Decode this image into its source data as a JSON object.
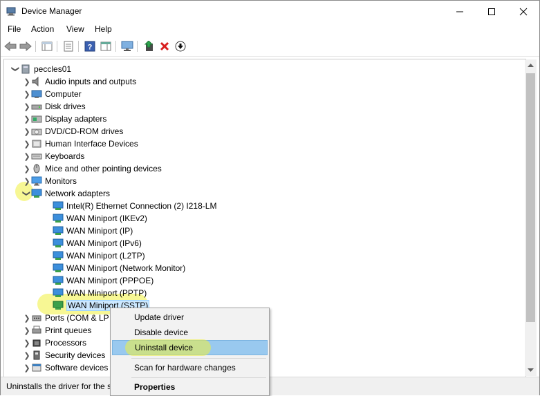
{
  "window": {
    "title": "Device Manager",
    "app_icon": "device-manager-icon"
  },
  "menu": [
    "File",
    "Action",
    "View",
    "Help"
  ],
  "toolbar_icons": [
    "back-arrow-icon",
    "forward-arrow-icon",
    "show-hide-tree-icon",
    "properties-icon",
    "help-icon",
    "action-pane-icon",
    "monitor-icon",
    "update-driver-icon",
    "uninstall-red-x-icon",
    "download-arrow-icon"
  ],
  "tree": {
    "root": "peccles01",
    "categories": [
      {
        "label": "Audio inputs and outputs",
        "icon": "speaker-icon"
      },
      {
        "label": "Computer",
        "icon": "computer-icon"
      },
      {
        "label": "Disk drives",
        "icon": "disk-drive-icon"
      },
      {
        "label": "Display adapters",
        "icon": "display-adapter-icon"
      },
      {
        "label": "DVD/CD-ROM drives",
        "icon": "dvd-drive-icon"
      },
      {
        "label": "Human Interface Devices",
        "icon": "hid-icon"
      },
      {
        "label": "Keyboards",
        "icon": "keyboard-icon"
      },
      {
        "label": "Mice and other pointing devices",
        "icon": "mouse-icon"
      },
      {
        "label": "Monitors",
        "icon": "monitor-icon"
      },
      {
        "label": "Network adapters",
        "icon": "network-adapter-icon"
      }
    ],
    "network_children": [
      "Intel(R) Ethernet Connection (2) I218-LM",
      "WAN Miniport (IKEv2)",
      "WAN Miniport (IP)",
      "WAN Miniport (IPv6)",
      "WAN Miniport (L2TP)",
      "WAN Miniport (Network Monitor)",
      "WAN Miniport (PPPOE)",
      "WAN Miniport (PPTP)",
      "WAN Miniport (SSTP)"
    ],
    "after_categories": [
      {
        "label": "Ports (COM & LP",
        "icon": "port-icon"
      },
      {
        "label": "Print queues",
        "icon": "printer-icon"
      },
      {
        "label": "Processors",
        "icon": "processor-icon"
      },
      {
        "label": "Security devices",
        "icon": "security-device-icon"
      },
      {
        "label": "Software devices",
        "icon": "software-device-icon"
      }
    ]
  },
  "context_menu": {
    "items": [
      "Update driver",
      "Disable device",
      "Uninstall device",
      "Scan for hardware changes",
      "Properties"
    ],
    "highlighted": "Uninstall device",
    "highlight_color": "#99c9ef"
  },
  "status": {
    "text": "Uninstalls the driver for the s"
  },
  "colors": {
    "highlight_marker": "#f0f03c",
    "selection": "#cce8ff"
  }
}
